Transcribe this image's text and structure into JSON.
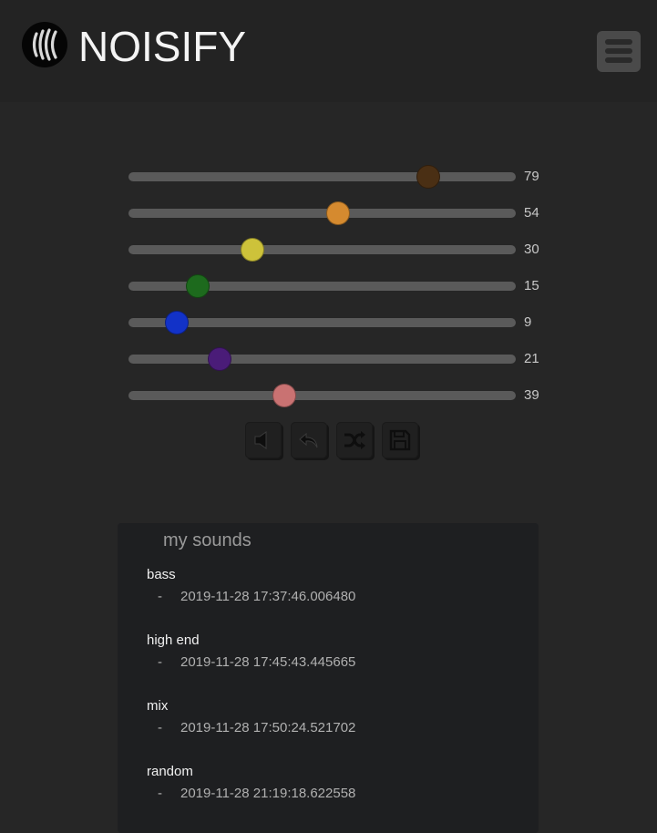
{
  "app": {
    "title": "NOISIFY"
  },
  "header": {
    "logo_icon": "sound-waves-icon",
    "menu_icon": "hamburger-menu-icon"
  },
  "sliders": [
    {
      "value": 79,
      "label": "79",
      "color": "#4a2f14"
    },
    {
      "value": 54,
      "label": "54",
      "color": "#d58a2f"
    },
    {
      "value": 30,
      "label": "30",
      "color": "#cdc23a"
    },
    {
      "value": 15,
      "label": "15",
      "color": "#1d6a1d"
    },
    {
      "value": 9,
      "label": "9",
      "color": "#1232c8"
    },
    {
      "value": 21,
      "label": "21",
      "color": "#4a1c78"
    },
    {
      "value": 39,
      "label": "39",
      "color": "#c97272"
    }
  ],
  "controls": [
    {
      "name": "mute",
      "icon": "speaker-mute-icon"
    },
    {
      "name": "undo",
      "icon": "undo-arrow-icon"
    },
    {
      "name": "shuffle",
      "icon": "shuffle-icon"
    },
    {
      "name": "save",
      "icon": "floppy-disk-icon"
    }
  ],
  "my_sounds": {
    "title": "my sounds",
    "items": [
      {
        "name": "bass",
        "dash": "-",
        "timestamp": "2019-11-28 17:37:46.006480"
      },
      {
        "name": "high end",
        "dash": "-",
        "timestamp": "2019-11-28 17:45:43.445665"
      },
      {
        "name": "mix",
        "dash": "-",
        "timestamp": "2019-11-28 17:50:24.521702"
      },
      {
        "name": "random",
        "dash": "-",
        "timestamp": "2019-11-28 21:19:18.622558"
      }
    ]
  }
}
